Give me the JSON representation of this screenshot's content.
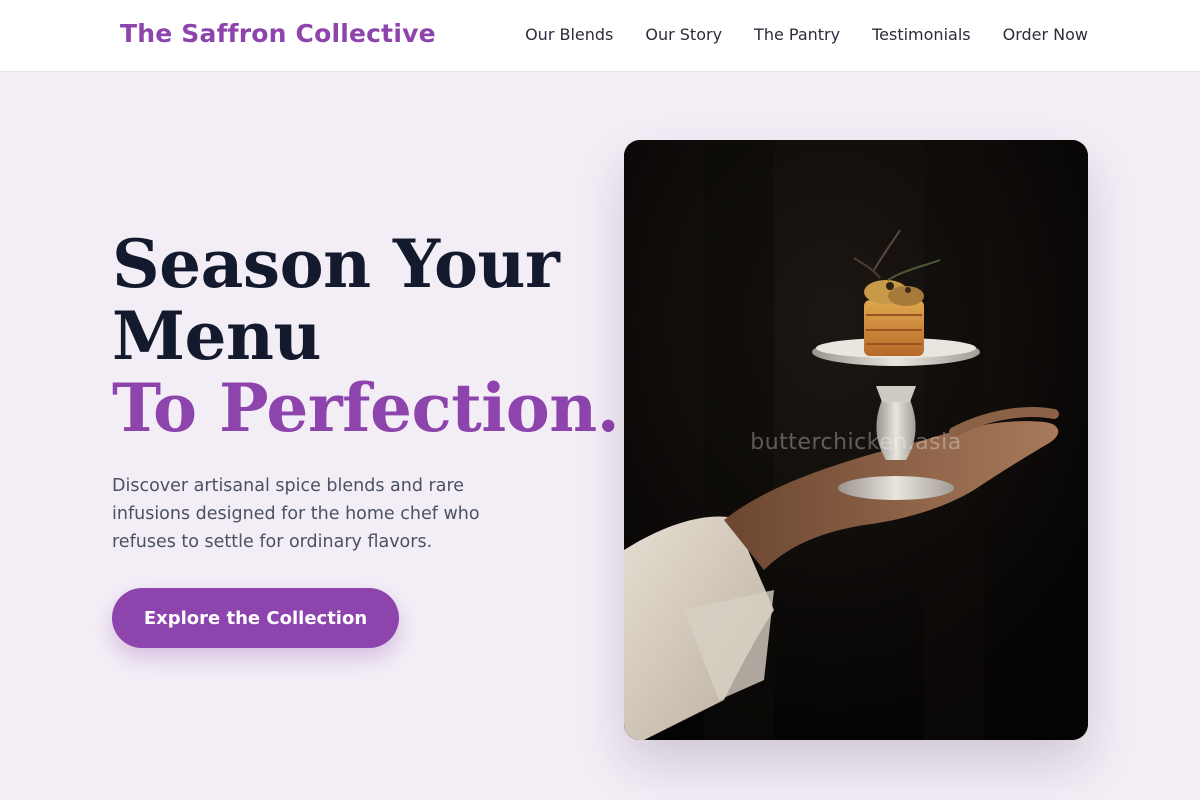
{
  "header": {
    "brand": "The Saffron Collective",
    "nav": [
      {
        "label": "Our Blends"
      },
      {
        "label": "Our Story"
      },
      {
        "label": "The Pantry"
      },
      {
        "label": "Testimonials"
      },
      {
        "label": "Order Now"
      }
    ]
  },
  "hero": {
    "title_line1": "Season Your",
    "title_line2": "Menu",
    "title_accent": "To Perfection.",
    "description": "Discover artisanal spice blends and rare infusions designed for the home chef who refuses to settle for ordinary flavors.",
    "cta_label": "Explore the Collection",
    "image_watermark": "butterchicken.asia"
  },
  "colors": {
    "accent": "#8e44ad",
    "heading": "#141a2e",
    "background": "#f3eef6"
  }
}
